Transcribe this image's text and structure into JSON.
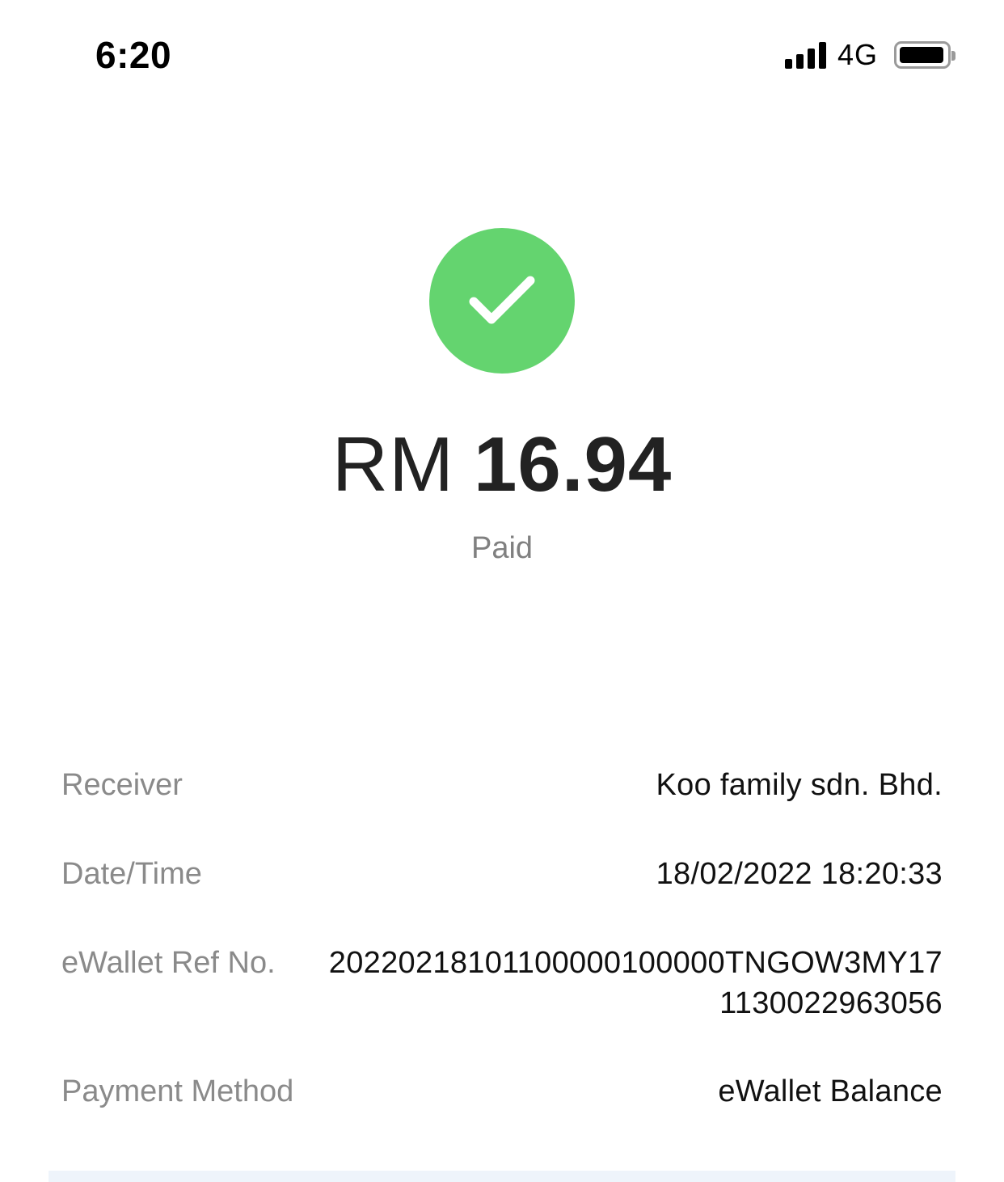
{
  "status_bar": {
    "time": "6:20",
    "network": "4G",
    "icons": [
      "signal-icon",
      "battery-icon"
    ]
  },
  "payment": {
    "currency": "RM",
    "amount": "16.94",
    "status": "Paid",
    "status_icon": "check-icon",
    "status_color": "#64d46f"
  },
  "details": [
    {
      "label": "Receiver",
      "value": "Koo family sdn. Bhd."
    },
    {
      "label": "Date/Time",
      "value": "18/02/2022 18:20:33"
    },
    {
      "label": "eWallet Ref No.",
      "value": "20220218101100000100000TNGOW3MY171130022963056"
    },
    {
      "label": "Payment Method",
      "value": "eWallet Balance"
    }
  ]
}
